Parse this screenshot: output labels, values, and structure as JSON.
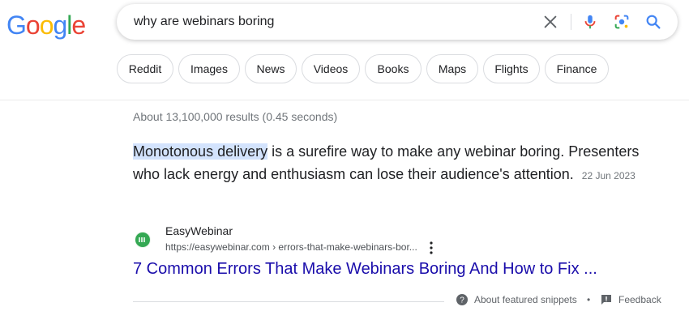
{
  "logo": {
    "letters": [
      "G",
      "o",
      "o",
      "g",
      "l",
      "e"
    ],
    "colors": [
      "#4285F4",
      "#EA4335",
      "#FBBC05",
      "#4285F4",
      "#34A853",
      "#EA4335"
    ]
  },
  "search": {
    "query": "why are webinars boring",
    "icons": [
      "clear-icon",
      "microphone-icon",
      "lens-icon",
      "search-icon"
    ]
  },
  "chips": [
    "Reddit",
    "Images",
    "News",
    "Videos",
    "Books",
    "Maps",
    "Flights",
    "Finance"
  ],
  "stats": "About 13,100,000 results (0.45 seconds)",
  "snippet": {
    "highlight": "Monotonous delivery",
    "text": " is a surefire way to make any webinar boring. Presenters who lack energy and enthusiasm can lose their audience's attention.",
    "date": "22 Jun 2023"
  },
  "source": {
    "name": "EasyWebinar",
    "url": "https://easywebinar.com › errors-that-make-webinars-bor...",
    "favicon_color": "#34A853"
  },
  "result": {
    "title": "7 Common Errors That Make Webinars Boring And How to Fix ..."
  },
  "footer": {
    "about": "About featured snippets",
    "separator": "•",
    "feedback": "Feedback"
  }
}
